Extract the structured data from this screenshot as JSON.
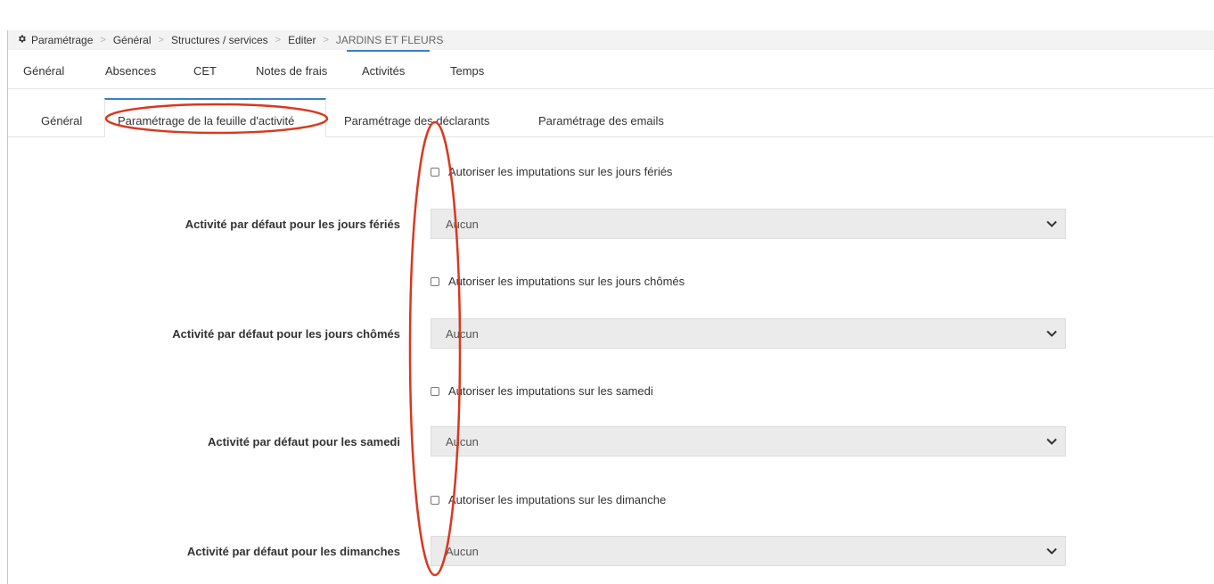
{
  "breadcrumb": {
    "icon": "gear-icon",
    "items": [
      "Paramétrage",
      "Général",
      "Structures / services",
      "Editer"
    ],
    "current": "JARDINS ET FLEURS"
  },
  "main_tabs": {
    "items": [
      "Général",
      "Absences",
      "CET",
      "Notes de frais",
      "Activités",
      "Temps"
    ],
    "active": "Activités"
  },
  "sub_tabs": {
    "items": [
      "Général",
      "Paramétrage de la feuille d'activité",
      "Paramétrage des déclarants",
      "Paramétrage des emails"
    ],
    "active": "Paramétrage de la feuille d'activité"
  },
  "form": {
    "check_feries": {
      "label": "Autoriser les imputations sur les jours fériés",
      "checked": false
    },
    "label_feries": "Activité par défaut pour les jours fériés",
    "select_feries": "Aucun",
    "check_chomes": {
      "label": "Autoriser les imputations sur les jours chômés",
      "checked": false
    },
    "label_chomes": "Activité par défaut pour les jours chômés",
    "select_chomes": "Aucun",
    "check_samedi": {
      "label": "Autoriser les imputations sur les samedi",
      "checked": false
    },
    "label_samedi": "Activité par défaut pour les samedi",
    "select_samedi": "Aucun",
    "check_dimanche": {
      "label": "Autoriser les imputations sur les dimanche",
      "checked": false
    },
    "label_dimanche": "Activité par défaut pour les dimanches",
    "select_dimanche": "Aucun"
  },
  "colors": {
    "accent": "#3a7fc1",
    "annotation": "#d9381e",
    "select_bg": "#ebebeb"
  }
}
